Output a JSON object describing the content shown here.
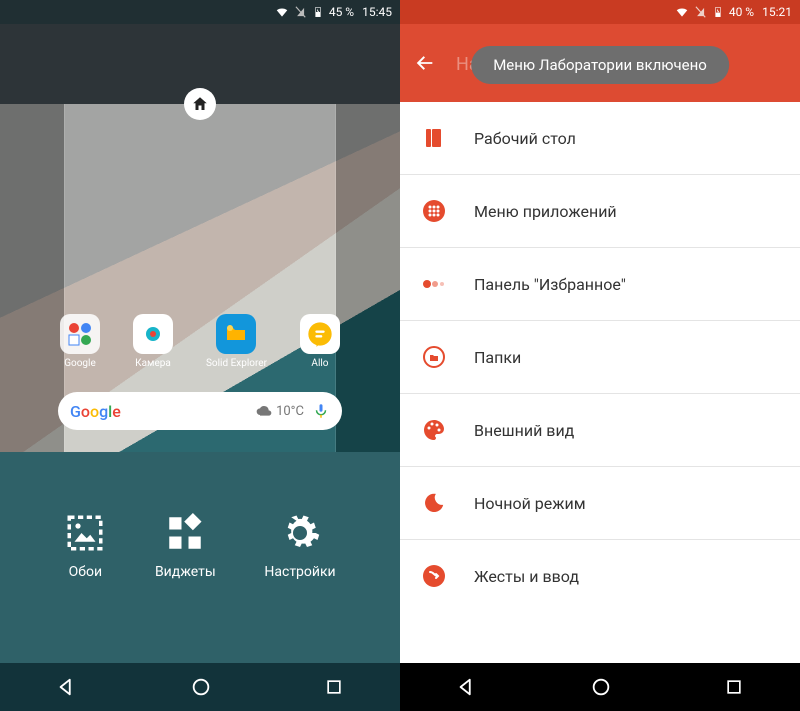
{
  "left": {
    "status": {
      "battery": "45 %",
      "time": "15:45"
    },
    "apps": [
      {
        "label": "Google"
      },
      {
        "label": "Камера"
      },
      {
        "label": "Solid Explorer"
      },
      {
        "label": "Allo"
      }
    ],
    "search": {
      "temp": "10°C"
    },
    "panel": {
      "wallpapers": "Обои",
      "widgets": "Виджеты",
      "settings": "Настройки"
    }
  },
  "right": {
    "status": {
      "battery": "40 %",
      "time": "15:21"
    },
    "header_title": "Настройки Nova",
    "toast": "Меню Лаборатории включено",
    "items": [
      {
        "label": "Рабочий стол"
      },
      {
        "label": "Меню приложений"
      },
      {
        "label": "Панель \"Избранное\""
      },
      {
        "label": "Папки"
      },
      {
        "label": "Внешний вид"
      },
      {
        "label": "Ночной режим"
      },
      {
        "label": "Жесты и ввод"
      }
    ]
  }
}
